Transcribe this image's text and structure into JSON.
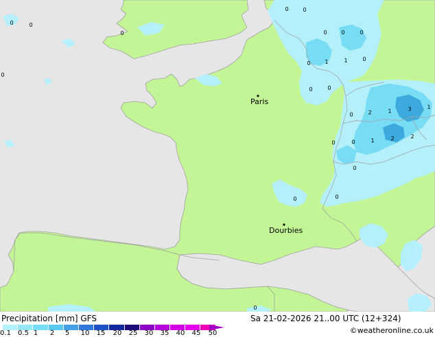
{
  "map": {
    "cities": [
      {
        "name": "Paris"
      },
      {
        "name": "Dourbies"
      }
    ],
    "precip_values": [
      "0",
      "0",
      "0",
      "0",
      "0",
      "0",
      "0",
      "0",
      "0",
      "1",
      "1",
      "0",
      "0",
      "0",
      "0",
      "0",
      "2",
      "1",
      "3",
      "1",
      "0",
      "0",
      "1",
      "2",
      "2",
      "0",
      "0",
      "0",
      "0"
    ]
  },
  "footer": {
    "title": "Precipitation [mm]  GFS",
    "datetime": "Sa 21-02-2026 21..00 UTC (12+324)",
    "credit": "©weatheronline.co.uk"
  },
  "legend": {
    "ticks": [
      "0.1",
      "0.5",
      "1",
      "2",
      "5",
      "10",
      "15",
      "20",
      "25",
      "30",
      "35",
      "40",
      "45",
      "50"
    ],
    "colors": [
      "#b4f0ff",
      "#96e6fa",
      "#78dcf5",
      "#5ac8f0",
      "#46a0e6",
      "#3278dc",
      "#1e50c8",
      "#1428a0",
      "#1e0a78",
      "#8c00c8",
      "#b400dc",
      "#d200e6",
      "#e600f0",
      "#f000b4"
    ]
  },
  "colors": {
    "land": "#c3f596",
    "sea": "#e6e6e6",
    "coast": "#a0a0a0",
    "light_precip": "#b4f0ff",
    "medium_precip": "#78dcf5",
    "heavy_precip": "#3caadc"
  }
}
